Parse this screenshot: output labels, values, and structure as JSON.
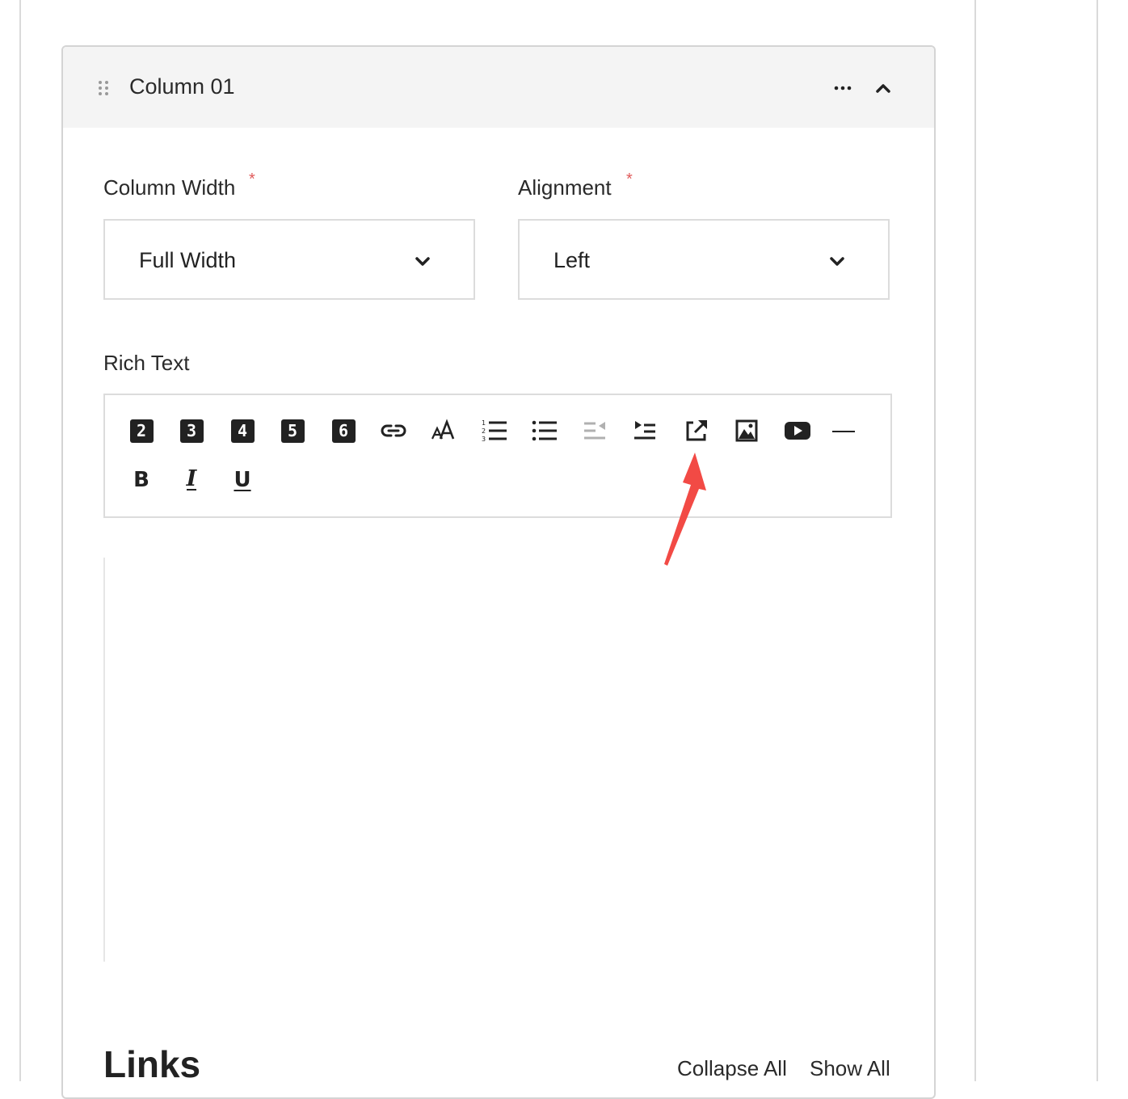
{
  "panel": {
    "title": "Column 01"
  },
  "fields": {
    "column_width": {
      "label": "Column Width",
      "required_mark": "*",
      "value": "Full Width"
    },
    "alignment": {
      "label": "Alignment",
      "required_mark": "*",
      "value": "Left"
    }
  },
  "rich_text": {
    "label": "Rich Text",
    "toolbar": {
      "headings": [
        "2",
        "3",
        "4",
        "5",
        "6"
      ],
      "format_buttons": [
        {
          "label": "B",
          "icon": "bold-icon"
        },
        {
          "label": "I",
          "icon": "italic-icon"
        },
        {
          "label": "U",
          "icon": "underline-icon"
        }
      ],
      "icons": [
        "link-icon",
        "font-size-icon",
        "ordered-list-icon",
        "unordered-list-icon",
        "outdent-icon",
        "indent-icon",
        "external-link-icon",
        "image-icon",
        "video-icon",
        "horizontal-rule-icon"
      ]
    }
  },
  "links": {
    "title": "Links",
    "collapse_all": "Collapse All",
    "show_all": "Show All"
  },
  "colors": {
    "required": "#e05a5a",
    "annotation": "#f24a45",
    "header_bg": "#f4f4f4",
    "border": "#d4d4d4"
  }
}
